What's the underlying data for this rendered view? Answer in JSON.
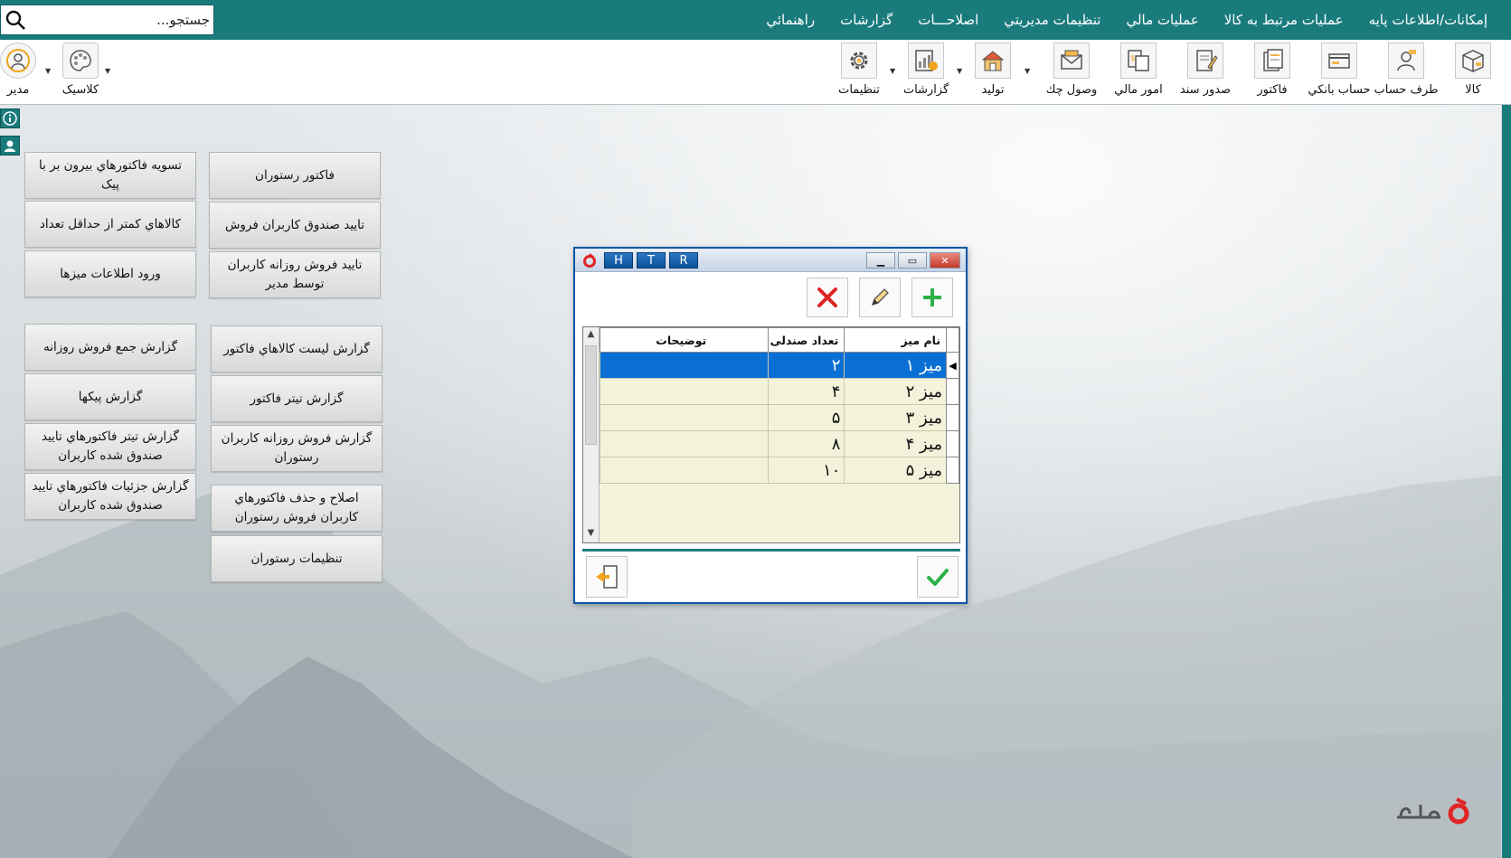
{
  "search": {
    "placeholder": "جستجو..."
  },
  "menu": {
    "items": [
      "إمكانات/اطلاعات پايه",
      "عمليات مرتبط به كالا",
      "عمليات مالي",
      "تنظيمات مديريتي",
      "اصلاحـــات",
      "گزارشات",
      "راهنمائي"
    ]
  },
  "toolbar": {
    "kala": "كالا",
    "taraf": "طرف حساب",
    "hesab": "حساب بانكي",
    "factor": "فاكتور",
    "sanad": "صدور سند",
    "mali": "امور مالي",
    "chek": "وصول چك",
    "tolid": "توليد",
    "gozareshat": "گزارشات",
    "tanzimat": "تنظيمات",
    "classic": "كلاسيک",
    "modir": "مدير"
  },
  "actions": {
    "col_right": [
      "فاكتور رستوران",
      "تاييد صندوق كاربران فروش",
      "تاييد فروش روزانه كاربران توسط مدير",
      "گزارش ليست كالاهاي فاكتور",
      "گزارش تيتر فاكتور",
      "گزارش فروش روزانه كاربران رستوران",
      "اصلاح و حذف فاكتورهاي كاربران فروش رستوران",
      "تنظيمات رستوران"
    ],
    "col_left": [
      "تسويه فاكتورهاي بيرون بر با پيک",
      "كالاهاي كمتر از حداقل تعداد",
      "ورود اطلاعات ميزها",
      "گزارش جمع فروش روزانه",
      "گزارش پيكها",
      "گزارش تيتر فاكتورهاي تاييد صندوق شده كاربران",
      "گزارش جزئيات فاكتورهاي تاييد صندوق شده كاربران"
    ]
  },
  "dialog": {
    "htr": [
      "H",
      "T",
      "R"
    ],
    "columns": {
      "name": "نام ميز",
      "seats": "تعداد صندلی",
      "desc": "توضيحات"
    },
    "rows": [
      {
        "name": "ميز ۱",
        "seats": "۲",
        "desc": ""
      },
      {
        "name": "ميز ۲",
        "seats": "۴",
        "desc": ""
      },
      {
        "name": "ميز ۳",
        "seats": "۵",
        "desc": ""
      },
      {
        "name": "ميز ۴",
        "seats": "۸",
        "desc": ""
      },
      {
        "name": "ميز ۵",
        "seats": "۱۰",
        "desc": ""
      }
    ],
    "selected_row": 0
  },
  "colors": {
    "teal": "#1a7b7d",
    "selection": "#0a6fd4",
    "grid_bg": "#f3f3dc",
    "brand_red": "#e02424"
  }
}
